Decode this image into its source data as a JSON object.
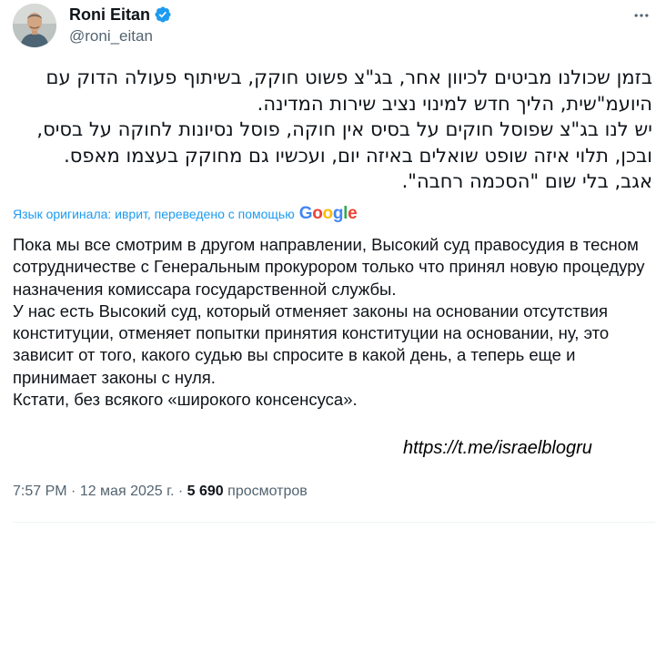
{
  "author": {
    "display_name": "Roni Eitan",
    "handle": "@roni_eitan",
    "verified": true,
    "verified_color": "#1d9bf0"
  },
  "tweet": {
    "original_text": "בזמן שכולנו מביטים לכיוון אחר, בג\"צ פשוט חוקק, בשיתוף פעולה הדוק עם היועמ\"שית, הליך חדש למינוי נציב שירות המדינה.\nיש לנו בג\"צ שפוסל חוקים על בסיס אין חוקה, פוסל נסיונות לחוקה על בסיס, ובכן, תלוי איזה שופט שואלים באיזה יום, ועכשיו גם מחוקק בעצמו מאפס.\nאגב, בלי שום \"הסכמה רחבה\".",
    "translation_label": "Язык оригинала: иврит, переведено с помощью",
    "translation_provider": "Google",
    "translated_text": "Пока мы все смотрим в другом направлении, Высокий суд правосудия в тесном сотрудничестве с Генеральным прокурором только что принял новую процедуру назначения комиссара государственной службы.\nУ нас есть Высокий суд, который отменяет законы на основании отсутствия конституции, отменяет попытки принятия конституции на основании, ну, это зависит от того, какого судью вы спросите в какой день, а теперь еще и принимает законы с нуля.\nКстати, без всякого «широкого консенсуса».",
    "link_text": "https://t.me/israelblogru"
  },
  "meta": {
    "time": "7:57 PM",
    "separator": " · ",
    "date": "12 мая 2025 г.",
    "views_count": "5 690",
    "views_label": "просмотров"
  },
  "colors": {
    "text": "#0f1419",
    "secondary": "#536471",
    "accent": "#1d9bf0"
  },
  "icons": {
    "more": "more-horizontal-icon",
    "verified": "verified-badge-icon"
  }
}
